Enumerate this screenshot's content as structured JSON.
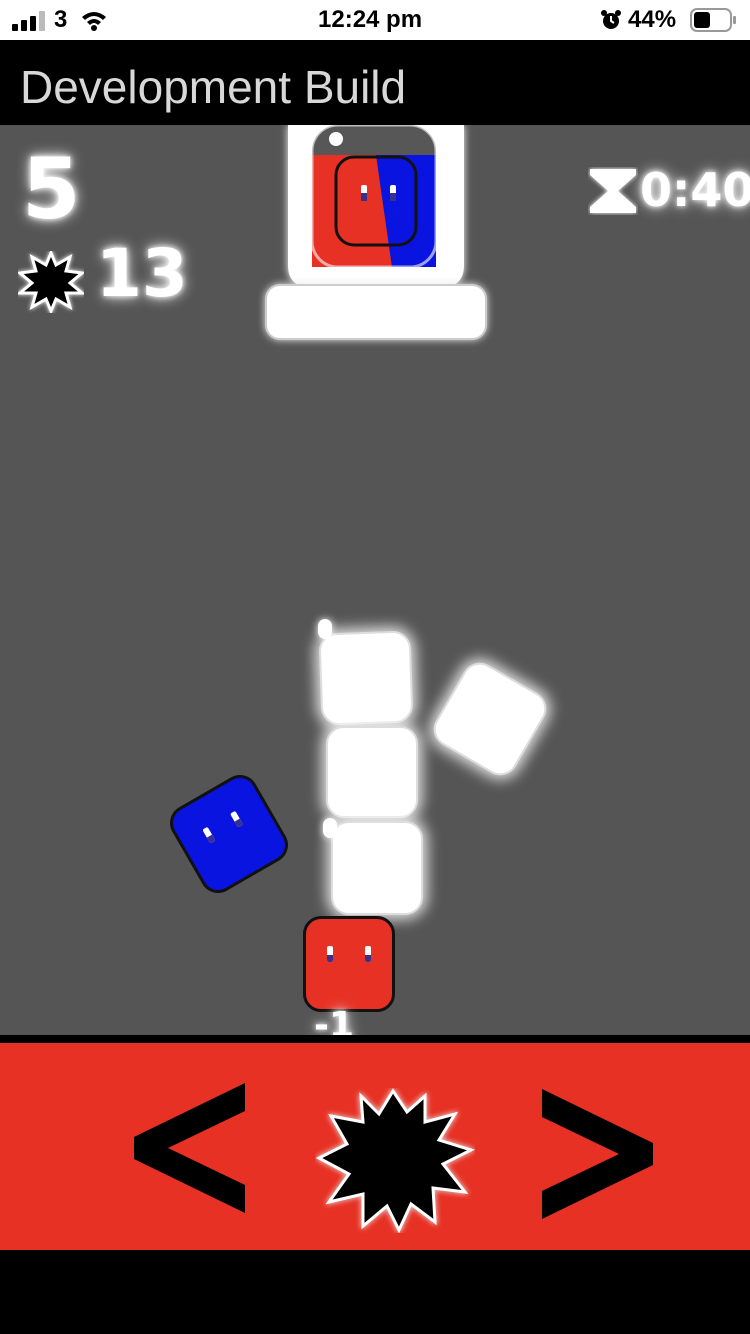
{
  "status_bar": {
    "carrier": "3",
    "time": "12:24 pm",
    "battery": "44%"
  },
  "header": {
    "title": "Development Build"
  },
  "hud": {
    "score": "5",
    "bombs_count": "13",
    "timer": "0:40"
  },
  "game": {
    "float_text": "-1",
    "colors": {
      "background": "#555555",
      "red": "#e63124",
      "blue": "#0a14e0",
      "block": "#ffffff"
    }
  },
  "controls": {
    "left_icon": "chevron-left-icon",
    "bomb_icon": "bomb-burst-icon",
    "right_icon": "chevron-right-icon"
  }
}
